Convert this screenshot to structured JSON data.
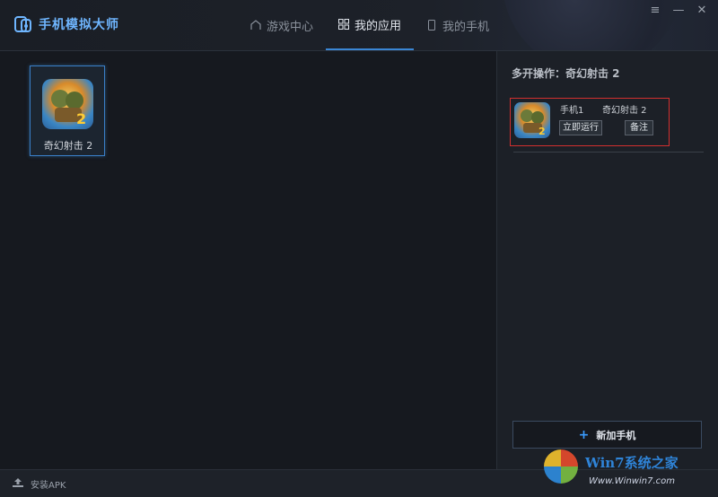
{
  "app": {
    "title": "手机模拟大师"
  },
  "nav": {
    "tabs": [
      {
        "label": "游戏中心",
        "icon": "home-icon",
        "active": false
      },
      {
        "label": "我的应用",
        "icon": "grid-icon",
        "active": true
      },
      {
        "label": "我的手机",
        "icon": "phone-icon",
        "active": false
      }
    ]
  },
  "window": {
    "menu": "≡",
    "minimize": "—",
    "close": "✕"
  },
  "apps": [
    {
      "name": "奇幻射击 2",
      "icon": "game-icon"
    }
  ],
  "side": {
    "title": "多开操作：奇幻射击 2",
    "phones": [
      {
        "phone": "手机1",
        "app": "奇幻射击 2",
        "run_label": "立即运行",
        "note_label": "备注"
      }
    ],
    "add_label": "新加手机"
  },
  "footer": {
    "install_label": "安装APK"
  },
  "watermark": {
    "brand": "Win7系统之家",
    "url": "Www.Winwin7.com"
  },
  "colors": {
    "accent": "#3a86d4",
    "highlight": "#d22f2f",
    "plus": "#3a9cff"
  }
}
